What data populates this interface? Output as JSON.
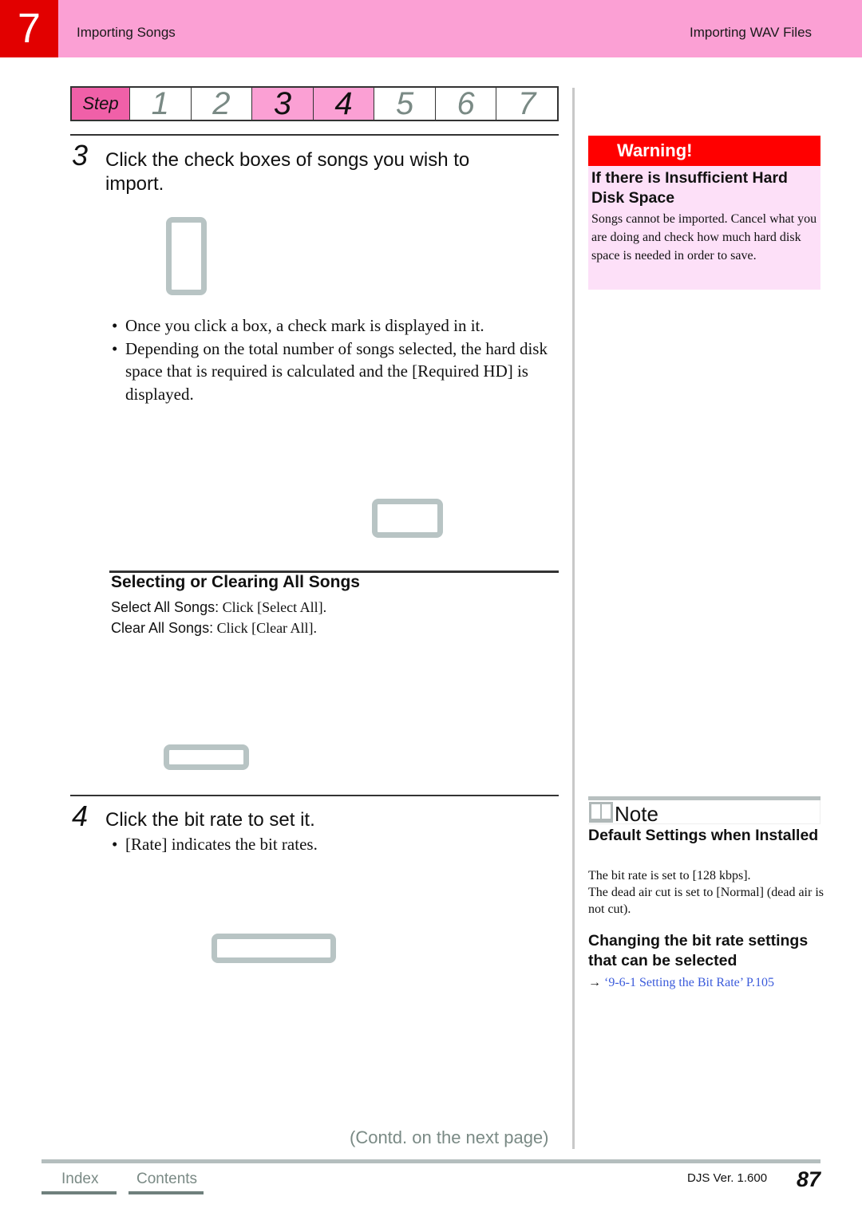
{
  "header": {
    "chapter_number": "7",
    "section_title": "Importing Songs",
    "page_topic": "Importing WAV Files"
  },
  "step_bar": {
    "label": "Step",
    "steps": [
      {
        "number": "1",
        "active": false
      },
      {
        "number": "2",
        "active": false
      },
      {
        "number": "3",
        "active": true
      },
      {
        "number": "4",
        "active": true
      },
      {
        "number": "5",
        "active": false
      },
      {
        "number": "6",
        "active": false
      },
      {
        "number": "7",
        "active": false
      }
    ]
  },
  "step3": {
    "number": "3",
    "title_line1": "Click the check boxes of songs you wish to",
    "title_line2": "import.",
    "bullets": [
      "Once you click a box, a check mark is displayed in it.",
      "Depending on the total number of songs selected, the hard disk space that is required is calculated and the [Required HD] is displayed."
    ],
    "bullet_symbol": "•"
  },
  "select_clear": {
    "heading": "Selecting or Clearing All Songs",
    "select_label": "Select All Songs:",
    "select_action": " Click [Select All].",
    "clear_label": "Clear All Songs:",
    "clear_action": " Click [Clear All]."
  },
  "step4": {
    "number": "4",
    "title": "Click the bit rate to set it.",
    "bullet": "[Rate] indicates the bit rates.",
    "bullet_symbol": "•"
  },
  "warning": {
    "label": "Warning!",
    "title": "If there is Insufficient Hard Disk Space",
    "text": "Songs cannot be imported. Cancel what you are doing and check how much hard disk space is needed in order to save.",
    "colors": {
      "bar": "#ff0000",
      "background": "#fde0f8"
    }
  },
  "note": {
    "icon": "book-icon",
    "label": "Note",
    "section1_title": "Default Settings when Installed",
    "section1_line1": "The bit rate is set to [128 kbps].",
    "section1_line2": "The dead air cut is set to [Normal] (dead air is not cut).",
    "section2_title": "Changing the bit rate settings that can be selected",
    "link_arrow": "→",
    "link_text": "‘9-6-1 Setting the Bit Rate’ P.105"
  },
  "footer": {
    "continued": "(Contd. on the next page)",
    "index_link": "Index",
    "contents_link": "Contents",
    "version": "DJS Ver. 1.600",
    "page_number": "87"
  },
  "colors": {
    "chapter_red": "#e20000",
    "header_pink": "#fba0d4",
    "step_label_pink": "#f060a8",
    "frame_gray": "#b8c4c4",
    "link_blue": "#3b5bdb"
  }
}
